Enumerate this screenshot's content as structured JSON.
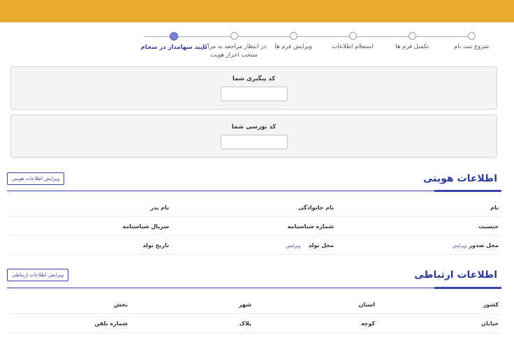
{
  "colors": {
    "topbar": "#e9ab2e",
    "accent": "#3a44a8"
  },
  "stepper": {
    "steps": [
      {
        "label": "شروع ثبت نام",
        "line2": "",
        "active": false
      },
      {
        "label": "تکمیل فرم ها",
        "line2": "",
        "active": false
      },
      {
        "label": "استعلام اطلاعات",
        "line2": "",
        "active": false
      },
      {
        "label": "ویرایش فرم ها",
        "line2": "",
        "active": false
      },
      {
        "label": "در انتظار مراجعه به مراکز",
        "line2": "منتخب احراز هویت",
        "active": false
      },
      {
        "label": "تایید سهامدار در سجام",
        "line2": "",
        "active": true
      }
    ]
  },
  "tracking": {
    "title": "کد پیگیری شما",
    "value": ""
  },
  "bourse": {
    "title": "کد بورسی شما",
    "value": ""
  },
  "identity": {
    "title": "اطلاعات هویتی",
    "edit_label": "ویرایش اطلاعات هویتی",
    "rows": [
      [
        "نام",
        "نام خانوادگی",
        "نام پدر"
      ],
      [
        "جنسیت",
        "شماره شناسنامه",
        "سریال شناسنامه"
      ],
      [
        "محل صدور",
        "محل تولد",
        "تاریخ تولد"
      ]
    ],
    "edit_link": "ویرایش"
  },
  "contact": {
    "title": "اطلاعات ارتباطی",
    "edit_label": "ویرایش اطلاعات ارتباطی",
    "rows": [
      [
        "کشور",
        "استان",
        "شهر",
        "بخش"
      ],
      [
        "خیابان",
        "کوچه",
        "پلاک",
        "شماره تلفن"
      ]
    ]
  }
}
